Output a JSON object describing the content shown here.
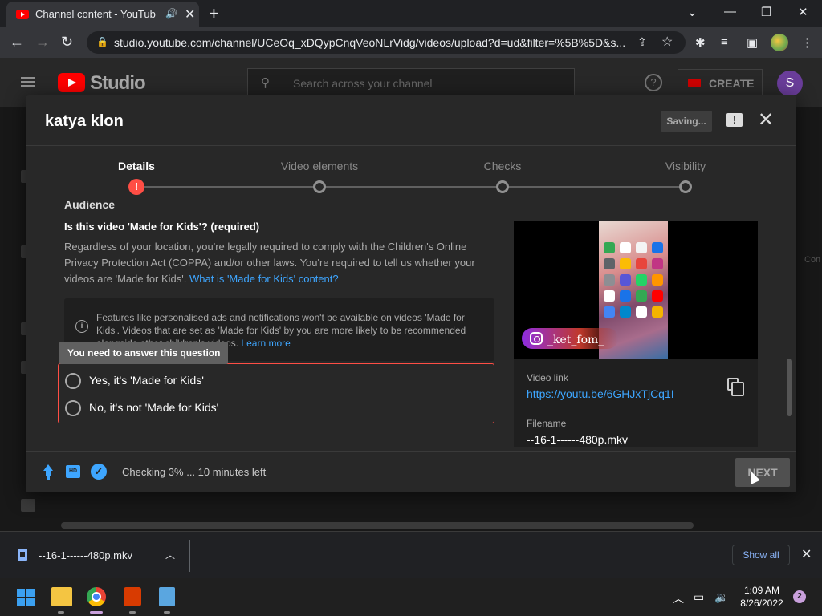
{
  "browser": {
    "tab_title": "Channel content - YouTube S",
    "tab_audio_icon": "speaker-icon",
    "url": "studio.youtube.com/channel/UCeOq_xDQypCnqVeoNLrVidg/videos/upload?d=ud&filter=%5B%5D&s..."
  },
  "studio": {
    "logo_text": "Studio",
    "search_placeholder": "Search across your channel",
    "create_label": "CREATE",
    "avatar_letter": "S",
    "right_edge_text": "Con"
  },
  "dialog": {
    "title": "katya klon",
    "saving_label": "Saving...",
    "steps": [
      {
        "label": "Details",
        "state": "error"
      },
      {
        "label": "Video elements",
        "state": "pending"
      },
      {
        "label": "Checks",
        "state": "pending"
      },
      {
        "label": "Visibility",
        "state": "pending"
      }
    ],
    "audience_heading": "Audience",
    "question": "Is this video 'Made for Kids'? (required)",
    "description": "Regardless of your location, you're legally required to comply with the Children's Online Privacy Protection Act (COPPA) and/or other laws. You're required to tell us whether your videos are 'Made for Kids'.",
    "description_link": "What is 'Made for Kids' content?",
    "info_text": "Features like personalised ads and notifications won't be available on videos 'Made for Kids'. Videos that are set as 'Made for Kids' by you are more likely to be recommended alongside other children's videos.",
    "info_link": "Learn more",
    "tooltip": "You need to answer this question",
    "options": [
      "Yes, it's 'Made for Kids'",
      "No, it's not 'Made for Kids'"
    ],
    "preview": {
      "overlay_text": "_ket_fom_",
      "video_link_label": "Video link",
      "video_link": "https://youtu.be/6GHJxTjCq1I",
      "filename_label": "Filename",
      "filename": "--16-1------480p.mkv"
    },
    "footer": {
      "status": "Checking 3% ... 10 minutes left",
      "hd_label": "HD",
      "next_label": "NEXT"
    }
  },
  "download_bar": {
    "filename": "--16-1------480p.mkv",
    "show_all": "Show all"
  },
  "taskbar": {
    "time": "1:09 AM",
    "date": "8/26/2022",
    "notifications": "2"
  },
  "colors": {
    "accent_blue": "#3ea6ff",
    "error_red": "#ff4e45",
    "brand_red": "#ff0000"
  }
}
